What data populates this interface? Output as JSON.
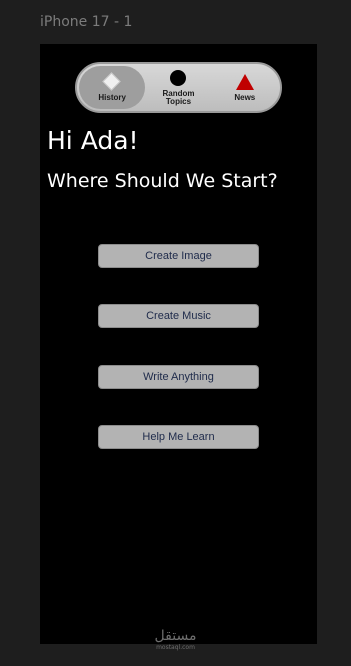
{
  "frame": {
    "label": "iPhone 17 - 1"
  },
  "topnav": {
    "items": [
      {
        "label": "History",
        "icon": "diamond-icon",
        "color": "#f0f0f0",
        "active": true
      },
      {
        "label": "Random\nTopics",
        "icon": "circle-icon",
        "color": "#000000",
        "active": false
      },
      {
        "label": "News",
        "icon": "triangle-icon",
        "color": "#c00000",
        "active": false
      }
    ]
  },
  "main": {
    "greeting": "Hi Ada!",
    "prompt": "Where Should We Start?",
    "actions": [
      {
        "label": "Create Image"
      },
      {
        "label": "Create Music"
      },
      {
        "label": "Write Anything"
      },
      {
        "label": "Help Me Learn"
      }
    ]
  },
  "watermark": {
    "arabic": "مستقل",
    "domain": "mostaql.com"
  }
}
